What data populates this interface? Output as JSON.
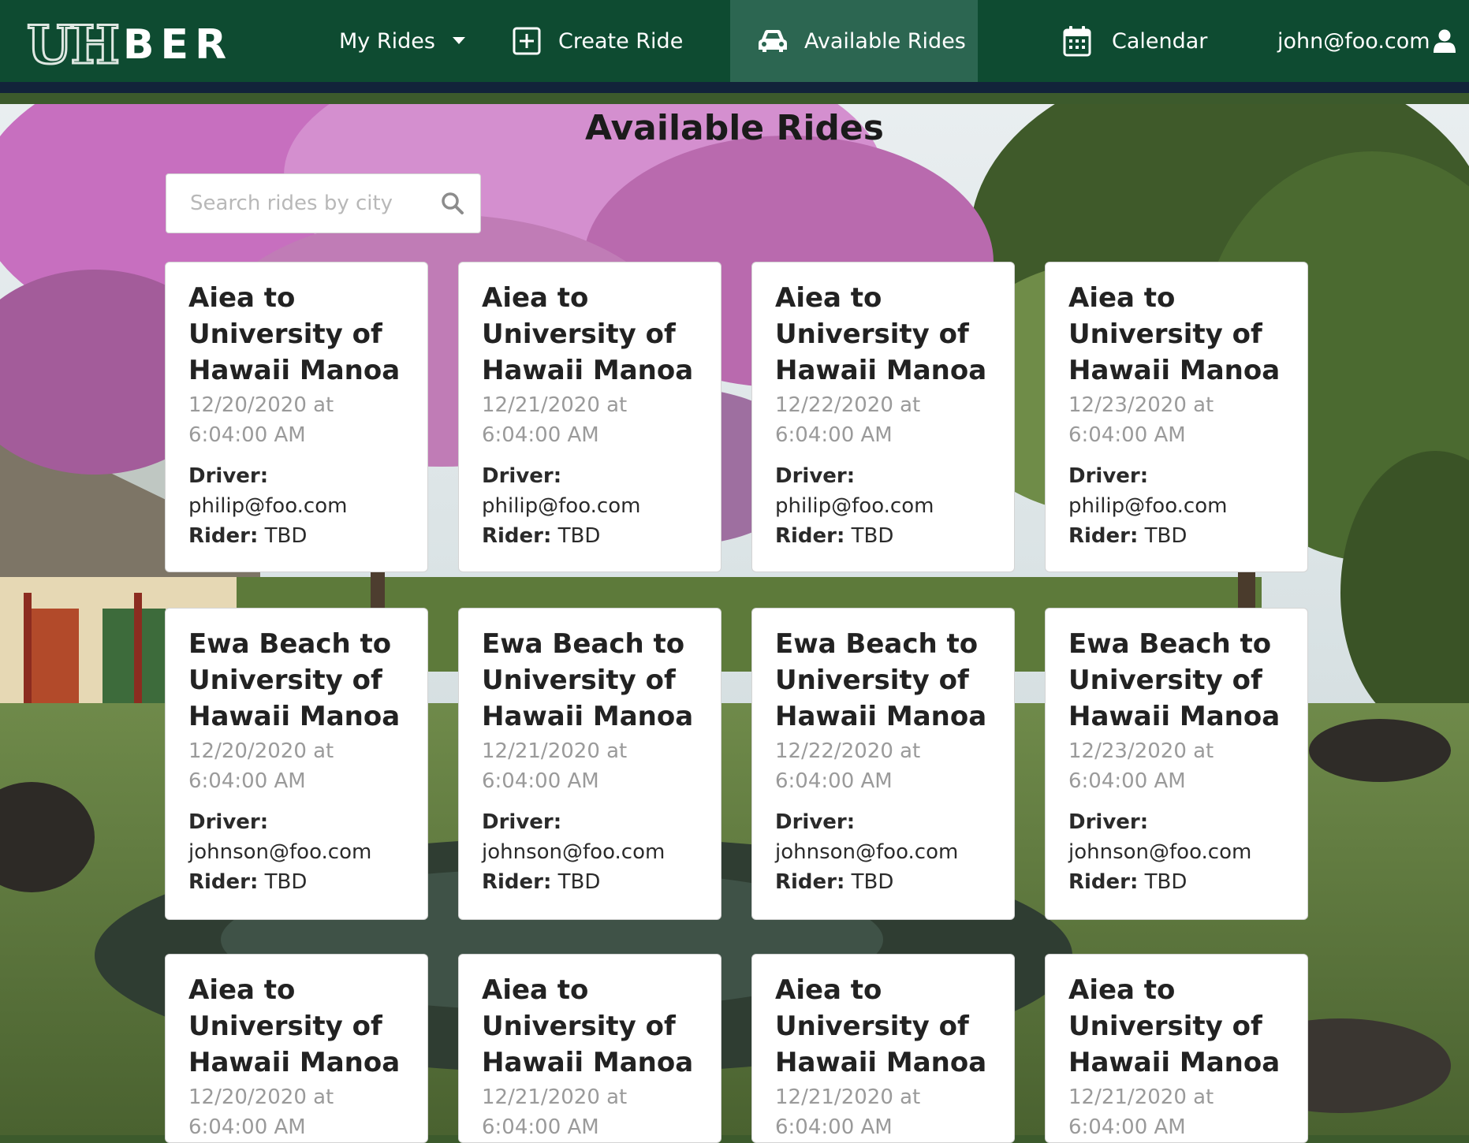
{
  "brand": {
    "uh": "UH",
    "ber": "BER"
  },
  "nav": {
    "my_rides": "My Rides",
    "create_ride": "Create Ride",
    "available_rides": "Available Rides",
    "calendar": "Calendar",
    "user_email": "john@foo.com"
  },
  "page": {
    "title": "Available Rides"
  },
  "search": {
    "placeholder": "Search rides by city",
    "value": ""
  },
  "labels": {
    "driver": "Driver:",
    "rider": "Rider:"
  },
  "rides": [
    {
      "title": "Aiea to University of Hawaii Manoa",
      "date": "12/20/2020 at",
      "time": "6:04:00 AM",
      "driver": "philip@foo.com",
      "rider": "TBD"
    },
    {
      "title": "Aiea to University of Hawaii Manoa",
      "date": "12/21/2020 at",
      "time": "6:04:00 AM",
      "driver": "philip@foo.com",
      "rider": "TBD"
    },
    {
      "title": "Aiea to University of Hawaii Manoa",
      "date": "12/22/2020 at",
      "time": "6:04:00 AM",
      "driver": "philip@foo.com",
      "rider": "TBD"
    },
    {
      "title": "Aiea to University of Hawaii Manoa",
      "date": "12/23/2020 at",
      "time": "6:04:00 AM",
      "driver": "philip@foo.com",
      "rider": "TBD"
    },
    {
      "title": "Ewa Beach to University of Hawaii Manoa",
      "date": "12/20/2020 at",
      "time": "6:04:00 AM",
      "driver": "johnson@foo.com",
      "rider": "TBD"
    },
    {
      "title": "Ewa Beach to University of Hawaii Manoa",
      "date": "12/21/2020 at",
      "time": "6:04:00 AM",
      "driver": "johnson@foo.com",
      "rider": "TBD"
    },
    {
      "title": "Ewa Beach to University of Hawaii Manoa",
      "date": "12/22/2020 at",
      "time": "6:04:00 AM",
      "driver": "johnson@foo.com",
      "rider": "TBD"
    },
    {
      "title": "Ewa Beach to University of Hawaii Manoa",
      "date": "12/23/2020 at",
      "time": "6:04:00 AM",
      "driver": "johnson@foo.com",
      "rider": "TBD"
    },
    {
      "title": "Aiea to University of Hawaii Manoa",
      "date": "12/20/2020 at",
      "time": "6:04:00 AM",
      "driver": "",
      "rider": ""
    },
    {
      "title": "Aiea to University of Hawaii Manoa",
      "date": "12/21/2020 at",
      "time": "6:04:00 AM",
      "driver": "",
      "rider": ""
    },
    {
      "title": "Aiea to University of Hawaii Manoa",
      "date": "12/21/2020 at",
      "time": "6:04:00 AM",
      "driver": "",
      "rider": ""
    },
    {
      "title": "Aiea to University of Hawaii Manoa",
      "date": "12/21/2020 at",
      "time": "6:04:00 AM",
      "driver": "",
      "rider": ""
    }
  ]
}
